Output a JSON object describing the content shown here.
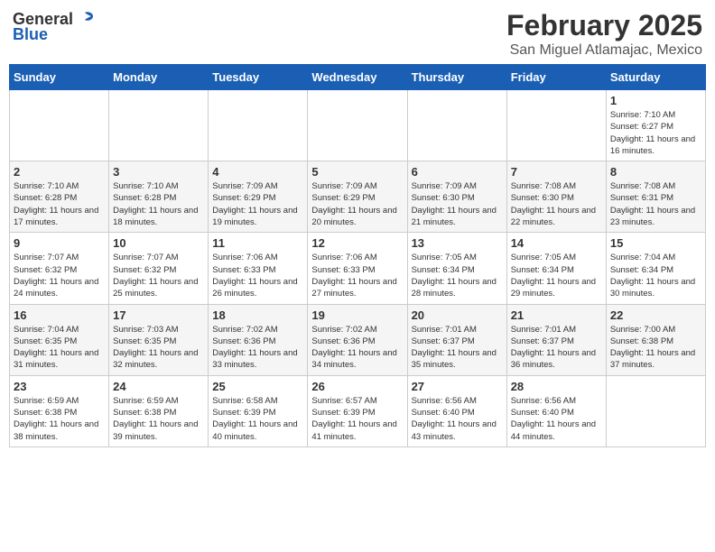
{
  "header": {
    "logo_general": "General",
    "logo_blue": "Blue",
    "main_title": "February 2025",
    "subtitle": "San Miguel Atlamajac, Mexico"
  },
  "days_of_week": [
    "Sunday",
    "Monday",
    "Tuesday",
    "Wednesday",
    "Thursday",
    "Friday",
    "Saturday"
  ],
  "weeks": [
    {
      "days": [
        {
          "number": "",
          "info": ""
        },
        {
          "number": "",
          "info": ""
        },
        {
          "number": "",
          "info": ""
        },
        {
          "number": "",
          "info": ""
        },
        {
          "number": "",
          "info": ""
        },
        {
          "number": "",
          "info": ""
        },
        {
          "number": "1",
          "info": "Sunrise: 7:10 AM\nSunset: 6:27 PM\nDaylight: 11 hours and 16 minutes."
        }
      ]
    },
    {
      "days": [
        {
          "number": "2",
          "info": "Sunrise: 7:10 AM\nSunset: 6:28 PM\nDaylight: 11 hours and 17 minutes."
        },
        {
          "number": "3",
          "info": "Sunrise: 7:10 AM\nSunset: 6:28 PM\nDaylight: 11 hours and 18 minutes."
        },
        {
          "number": "4",
          "info": "Sunrise: 7:09 AM\nSunset: 6:29 PM\nDaylight: 11 hours and 19 minutes."
        },
        {
          "number": "5",
          "info": "Sunrise: 7:09 AM\nSunset: 6:29 PM\nDaylight: 11 hours and 20 minutes."
        },
        {
          "number": "6",
          "info": "Sunrise: 7:09 AM\nSunset: 6:30 PM\nDaylight: 11 hours and 21 minutes."
        },
        {
          "number": "7",
          "info": "Sunrise: 7:08 AM\nSunset: 6:30 PM\nDaylight: 11 hours and 22 minutes."
        },
        {
          "number": "8",
          "info": "Sunrise: 7:08 AM\nSunset: 6:31 PM\nDaylight: 11 hours and 23 minutes."
        }
      ]
    },
    {
      "days": [
        {
          "number": "9",
          "info": "Sunrise: 7:07 AM\nSunset: 6:32 PM\nDaylight: 11 hours and 24 minutes."
        },
        {
          "number": "10",
          "info": "Sunrise: 7:07 AM\nSunset: 6:32 PM\nDaylight: 11 hours and 25 minutes."
        },
        {
          "number": "11",
          "info": "Sunrise: 7:06 AM\nSunset: 6:33 PM\nDaylight: 11 hours and 26 minutes."
        },
        {
          "number": "12",
          "info": "Sunrise: 7:06 AM\nSunset: 6:33 PM\nDaylight: 11 hours and 27 minutes."
        },
        {
          "number": "13",
          "info": "Sunrise: 7:05 AM\nSunset: 6:34 PM\nDaylight: 11 hours and 28 minutes."
        },
        {
          "number": "14",
          "info": "Sunrise: 7:05 AM\nSunset: 6:34 PM\nDaylight: 11 hours and 29 minutes."
        },
        {
          "number": "15",
          "info": "Sunrise: 7:04 AM\nSunset: 6:34 PM\nDaylight: 11 hours and 30 minutes."
        }
      ]
    },
    {
      "days": [
        {
          "number": "16",
          "info": "Sunrise: 7:04 AM\nSunset: 6:35 PM\nDaylight: 11 hours and 31 minutes."
        },
        {
          "number": "17",
          "info": "Sunrise: 7:03 AM\nSunset: 6:35 PM\nDaylight: 11 hours and 32 minutes."
        },
        {
          "number": "18",
          "info": "Sunrise: 7:02 AM\nSunset: 6:36 PM\nDaylight: 11 hours and 33 minutes."
        },
        {
          "number": "19",
          "info": "Sunrise: 7:02 AM\nSunset: 6:36 PM\nDaylight: 11 hours and 34 minutes."
        },
        {
          "number": "20",
          "info": "Sunrise: 7:01 AM\nSunset: 6:37 PM\nDaylight: 11 hours and 35 minutes."
        },
        {
          "number": "21",
          "info": "Sunrise: 7:01 AM\nSunset: 6:37 PM\nDaylight: 11 hours and 36 minutes."
        },
        {
          "number": "22",
          "info": "Sunrise: 7:00 AM\nSunset: 6:38 PM\nDaylight: 11 hours and 37 minutes."
        }
      ]
    },
    {
      "days": [
        {
          "number": "23",
          "info": "Sunrise: 6:59 AM\nSunset: 6:38 PM\nDaylight: 11 hours and 38 minutes."
        },
        {
          "number": "24",
          "info": "Sunrise: 6:59 AM\nSunset: 6:38 PM\nDaylight: 11 hours and 39 minutes."
        },
        {
          "number": "25",
          "info": "Sunrise: 6:58 AM\nSunset: 6:39 PM\nDaylight: 11 hours and 40 minutes."
        },
        {
          "number": "26",
          "info": "Sunrise: 6:57 AM\nSunset: 6:39 PM\nDaylight: 11 hours and 41 minutes."
        },
        {
          "number": "27",
          "info": "Sunrise: 6:56 AM\nSunset: 6:40 PM\nDaylight: 11 hours and 43 minutes."
        },
        {
          "number": "28",
          "info": "Sunrise: 6:56 AM\nSunset: 6:40 PM\nDaylight: 11 hours and 44 minutes."
        },
        {
          "number": "",
          "info": ""
        }
      ]
    }
  ]
}
